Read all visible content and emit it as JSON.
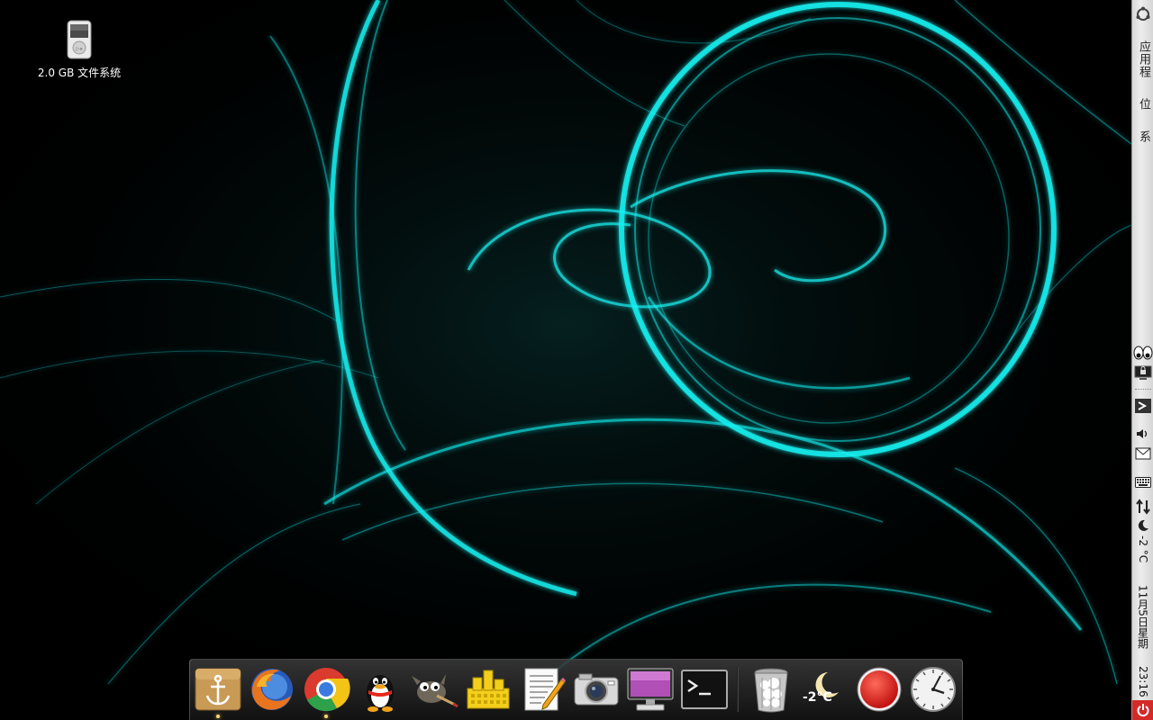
{
  "desktop": {
    "icons": [
      {
        "label": "2.0 GB 文件系统",
        "icon": "ipod-drive-icon"
      }
    ]
  },
  "panel": {
    "logo": "ubuntu-logo-icon",
    "menus": [
      {
        "label": "应用程",
        "icon": "applications-menu"
      },
      {
        "label": "位",
        "icon": "places-menu"
      },
      {
        "label": "系",
        "icon": "system-menu"
      }
    ],
    "indicators": [
      "eyes-icon",
      "lock-screen-icon",
      "network-manager-icon",
      "volume-icon",
      "mail-icon",
      "keyboard-icon",
      "transfer-icon",
      "weather-moon-icon"
    ],
    "weather_text": "-2 °C",
    "date_text": "11月5日星期",
    "time_text": "23:16",
    "power_icon": "power-icon"
  },
  "dock": {
    "items": [
      {
        "name": "anchor-launcher",
        "icon": "anchor-icon",
        "running": true
      },
      {
        "name": "firefox",
        "icon": "firefox-icon",
        "running": false
      },
      {
        "name": "chrome",
        "icon": "chrome-icon",
        "running": true
      },
      {
        "name": "qq",
        "icon": "qq-penguin-icon",
        "running": false
      },
      {
        "name": "gimp",
        "icon": "gimp-icon",
        "running": false
      },
      {
        "name": "libreoffice-calc",
        "icon": "spreadsheet-icon",
        "running": false
      },
      {
        "name": "text-editor",
        "icon": "text-editor-icon",
        "running": false
      },
      {
        "name": "camera",
        "icon": "camera-icon",
        "running": false
      },
      {
        "name": "display-settings",
        "icon": "monitor-icon",
        "running": false
      },
      {
        "name": "terminal",
        "icon": "terminal-icon",
        "running": false
      },
      {
        "name": "trash",
        "icon": "trash-icon",
        "running": false
      },
      {
        "name": "weather",
        "icon": "weather-moon-icon",
        "running": false
      },
      {
        "name": "record",
        "icon": "record-icon",
        "running": false
      },
      {
        "name": "clock",
        "icon": "clock-icon",
        "running": false
      }
    ],
    "weather_temp": "-2°C",
    "colors": {
      "accent": "#00e5e5",
      "record": "#e02020"
    }
  }
}
